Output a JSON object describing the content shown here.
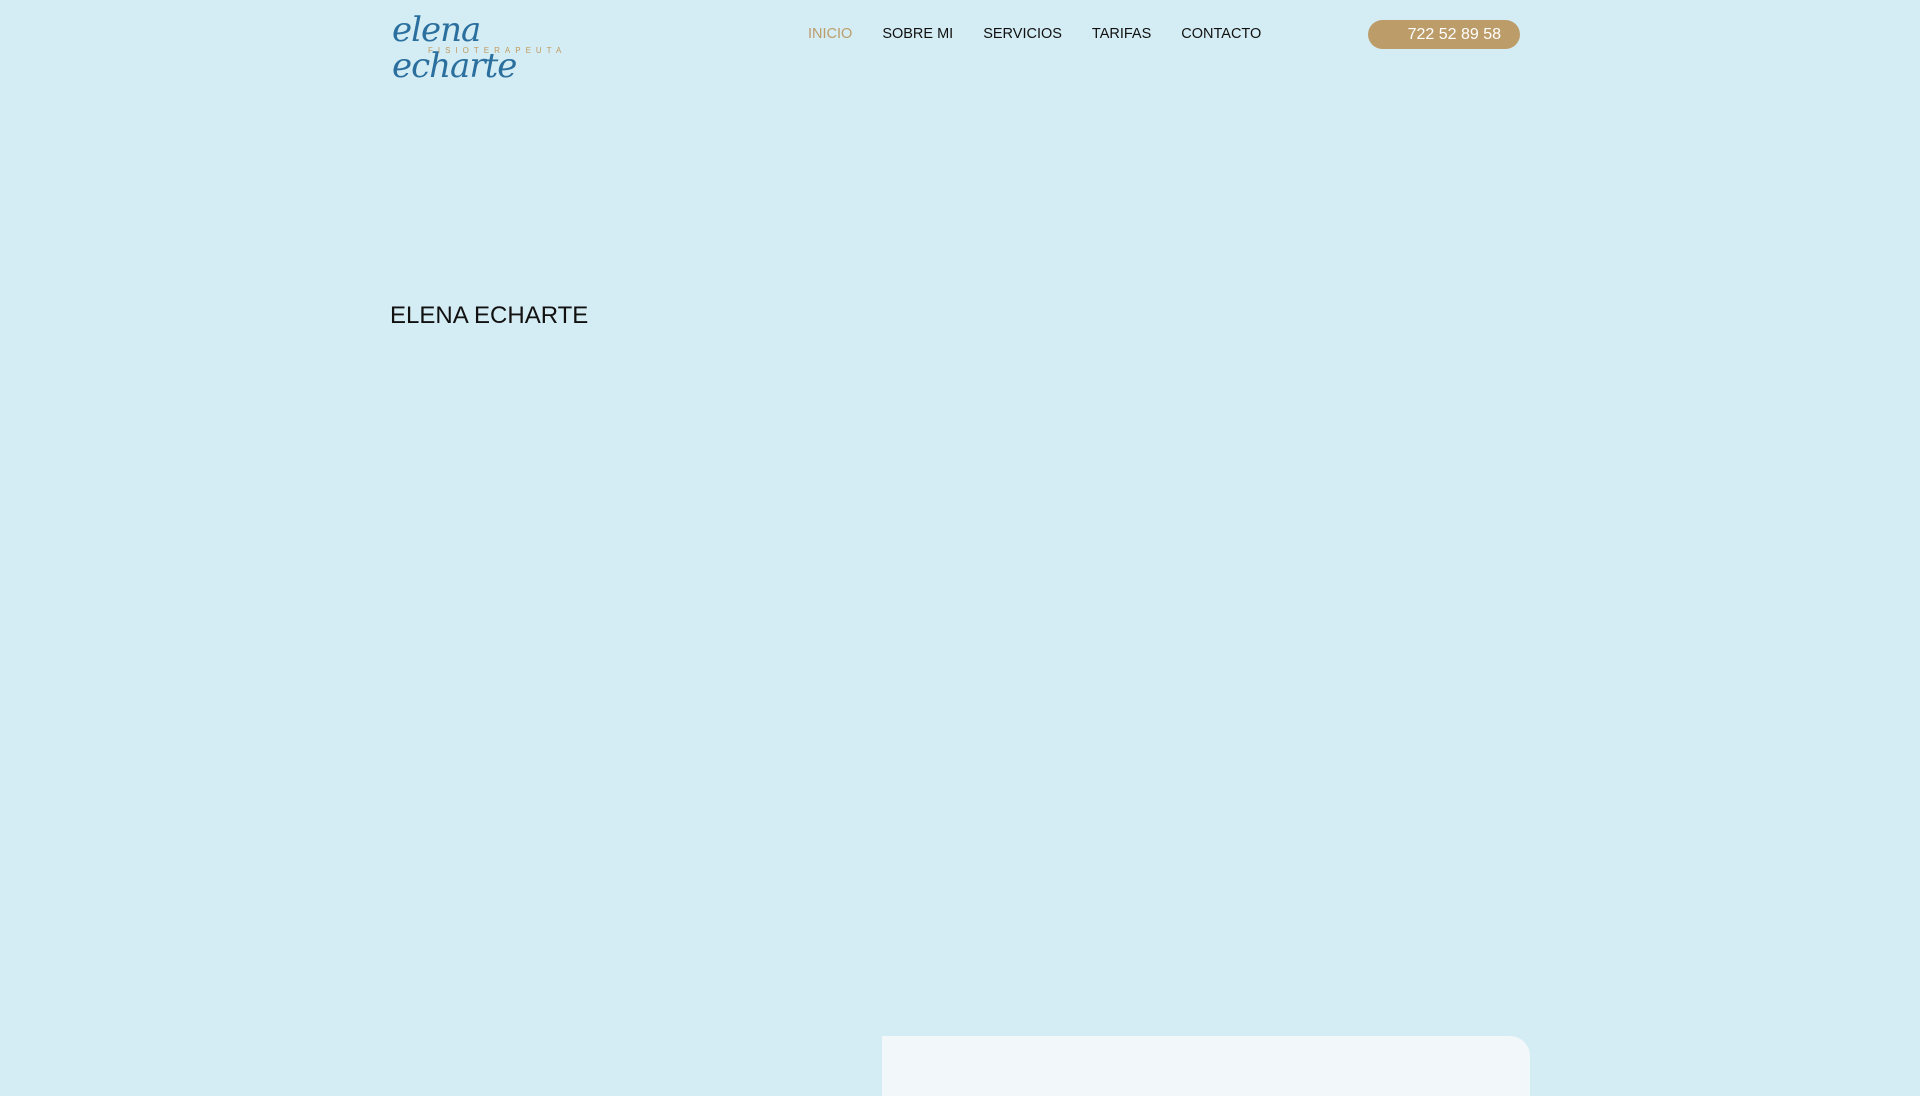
{
  "header": {
    "logo": {
      "name": "elena echarte",
      "subtitle": "FISIOTERAPEUTA"
    },
    "nav": [
      {
        "label": "INICIO",
        "active": true
      },
      {
        "label": "SOBRE MI",
        "active": false
      },
      {
        "label": "SERVICIOS",
        "active": false
      },
      {
        "label": "TARIFAS",
        "active": false
      },
      {
        "label": "CONTACTO",
        "active": false
      }
    ],
    "phone": "722 52 89 58"
  },
  "hero": {
    "title": "ELENA ECHARTE"
  },
  "colors": {
    "background": "#d4ecf3",
    "accent": "#bc9d6a",
    "logo": "#2a6f9e",
    "panel": "#f2f7fa"
  }
}
